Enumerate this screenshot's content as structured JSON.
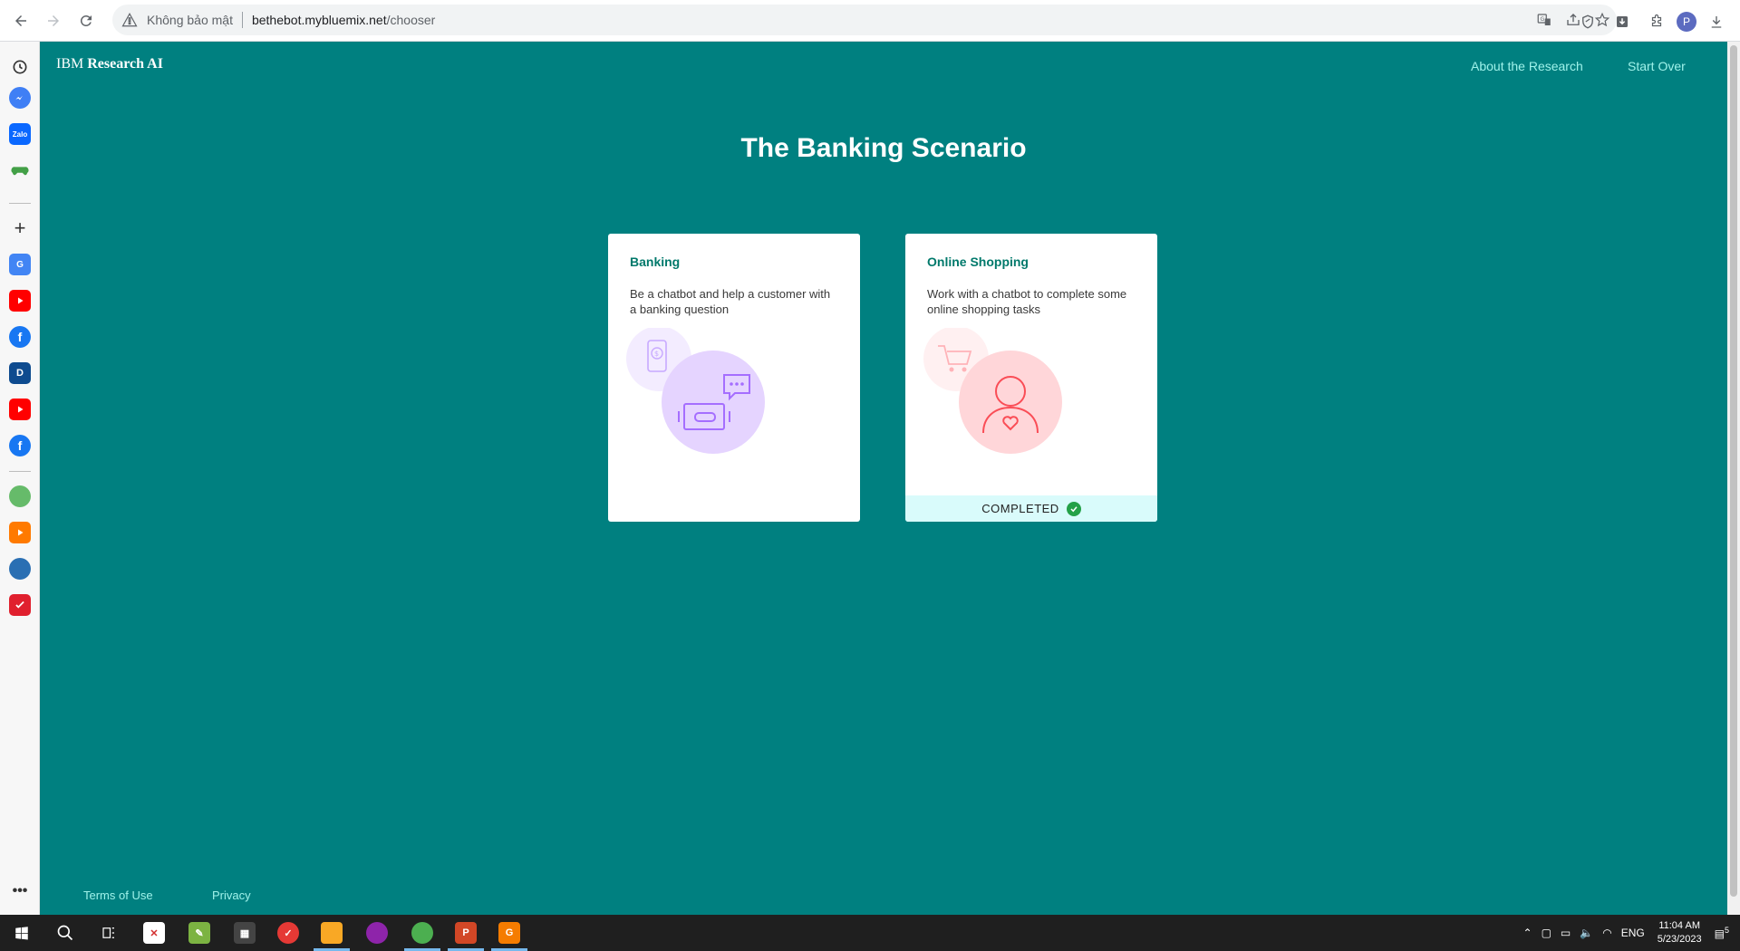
{
  "browser": {
    "security_label": "Không bảo mật",
    "url_host": "bethebot.mybluemix.net",
    "url_path": "/chooser",
    "profile_initial": "P"
  },
  "header": {
    "brand_prefix": "IBM",
    "brand_name": "Research AI",
    "about_link": "About the Research",
    "start_over_link": "Start Over"
  },
  "main": {
    "title": "The Banking Scenario",
    "cards": [
      {
        "title": "Banking",
        "description": "Be a chatbot and help a customer with a banking question",
        "completed": false
      },
      {
        "title": "Online Shopping",
        "description": "Work with a chatbot to complete some online shopping tasks",
        "completed": true,
        "status_label": "COMPLETED"
      }
    ]
  },
  "footer": {
    "terms": "Terms of Use",
    "privacy": "Privacy"
  },
  "taskbar": {
    "language": "ENG",
    "time": "11:04 AM",
    "date": "5/23/2023",
    "notification_count": "5"
  },
  "colors": {
    "page_background": "#008080",
    "accent_link": "#9ff2ea",
    "banking_purple": "#e8daff",
    "shopping_pink": "#ffd6d9",
    "completed_green": "#24a148"
  }
}
